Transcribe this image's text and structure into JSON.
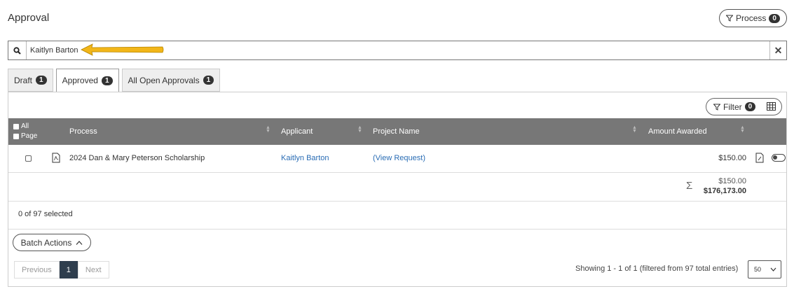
{
  "page": {
    "title": "Approval"
  },
  "process_button": {
    "label": "Process",
    "count": "0"
  },
  "search": {
    "value": "Kaitlyn Barton"
  },
  "tabs": [
    {
      "label": "Draft",
      "count": "1",
      "active": false
    },
    {
      "label": "Approved",
      "count": "1",
      "active": true
    },
    {
      "label": "All Open Approvals",
      "count": "1",
      "active": false
    }
  ],
  "filter_button": {
    "label": "Filter",
    "count": "0"
  },
  "table": {
    "header": {
      "all": "All",
      "page": "Page",
      "process": "Process",
      "applicant": "Applicant",
      "project_name": "Project Name",
      "amount_awarded": "Amount Awarded"
    },
    "rows": [
      {
        "process": "2024 Dan & Mary Peterson Scholarship",
        "applicant": "Kaitlyn Barton",
        "project_name": "(View Request)",
        "amount_awarded": "$150.00"
      }
    ],
    "totals": {
      "subtotal": "$150.00",
      "grand_total": "$176,173.00"
    }
  },
  "selection": {
    "text": "0 of 97 selected"
  },
  "batch_actions": {
    "label": "Batch Actions"
  },
  "pagination": {
    "previous": "Previous",
    "current": "1",
    "next": "Next",
    "showing": "Showing 1 - 1 of 1 (filtered from 97 total entries)",
    "page_size": "50"
  },
  "colors": {
    "header_bg": "#777777",
    "link": "#2a6db5",
    "highlight_arrow": "#f2b619"
  }
}
